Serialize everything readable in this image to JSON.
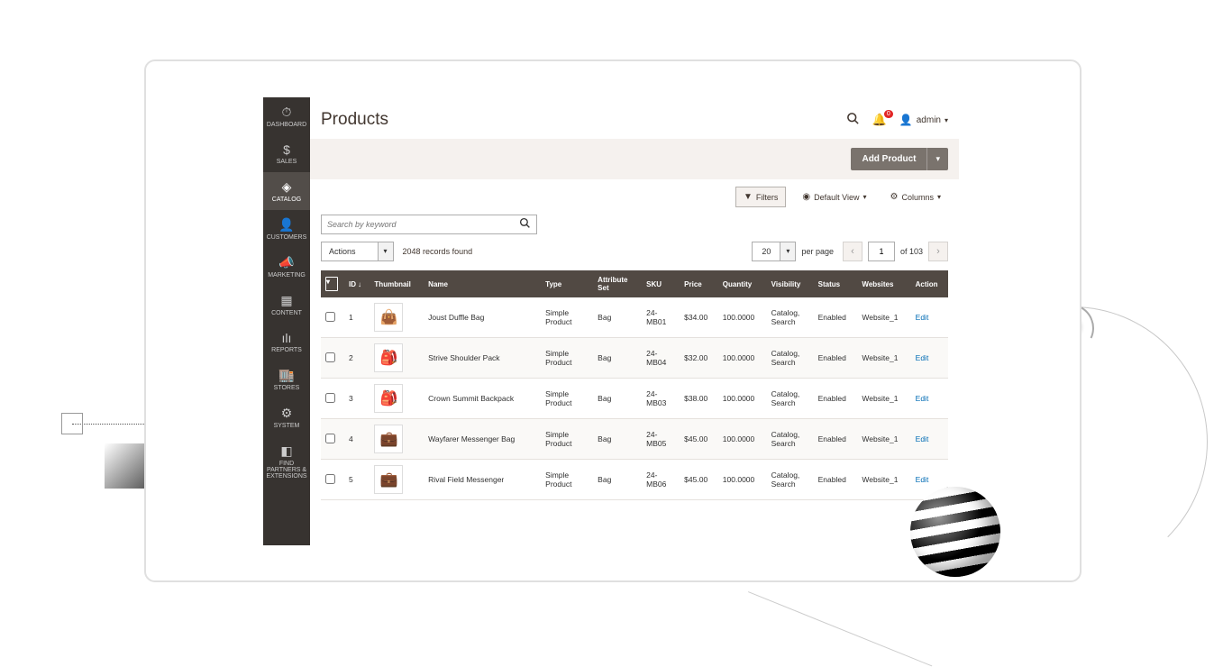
{
  "header": {
    "title": "Products",
    "notification_count": "0",
    "user_label": "admin"
  },
  "sidebar": {
    "items": [
      {
        "label": "DASHBOARD",
        "icon": "⏱"
      },
      {
        "label": "SALES",
        "icon": "$"
      },
      {
        "label": "CATALOG",
        "icon": "◈",
        "active": true
      },
      {
        "label": "CUSTOMERS",
        "icon": "👤"
      },
      {
        "label": "MARKETING",
        "icon": "📣"
      },
      {
        "label": "CONTENT",
        "icon": "▦"
      },
      {
        "label": "REPORTS",
        "icon": "ılı"
      },
      {
        "label": "STORES",
        "icon": "🏬"
      },
      {
        "label": "SYSTEM",
        "icon": "⚙"
      },
      {
        "label": "FIND PARTNERS & EXTENSIONS",
        "icon": "◧"
      }
    ]
  },
  "buttons": {
    "add_product": "Add Product"
  },
  "toolbar": {
    "filters": "Filters",
    "default_view": "Default View",
    "columns": "Columns"
  },
  "search": {
    "placeholder": "Search by keyword"
  },
  "actions": {
    "label": "Actions",
    "records_found": "2048 records found"
  },
  "paging": {
    "per_page_value": "20",
    "per_page_label": "per page",
    "current_page": "1",
    "total_pages_label": "of 103"
  },
  "table": {
    "headers": {
      "checkbox": "",
      "id": "ID",
      "thumbnail": "Thumbnail",
      "name": "Name",
      "type": "Type",
      "attribute_set": "Attribute Set",
      "sku": "SKU",
      "price": "Price",
      "quantity": "Quantity",
      "visibility": "Visibility",
      "status": "Status",
      "websites": "Websites",
      "action": "Action"
    },
    "rows": [
      {
        "id": "1",
        "thumb": "👜",
        "name": "Joust Duffle Bag",
        "type": "Simple Product",
        "set": "Bag",
        "sku": "24-MB01",
        "price": "$34.00",
        "qty": "100.0000",
        "vis": "Catalog, Search",
        "status": "Enabled",
        "web": "Website_1",
        "action": "Edit"
      },
      {
        "id": "2",
        "thumb": "🎒",
        "name": "Strive Shoulder Pack",
        "type": "Simple Product",
        "set": "Bag",
        "sku": "24-MB04",
        "price": "$32.00",
        "qty": "100.0000",
        "vis": "Catalog, Search",
        "status": "Enabled",
        "web": "Website_1",
        "action": "Edit"
      },
      {
        "id": "3",
        "thumb": "🎒",
        "name": "Crown Summit Backpack",
        "type": "Simple Product",
        "set": "Bag",
        "sku": "24-MB03",
        "price": "$38.00",
        "qty": "100.0000",
        "vis": "Catalog, Search",
        "status": "Enabled",
        "web": "Website_1",
        "action": "Edit"
      },
      {
        "id": "4",
        "thumb": "💼",
        "name": "Wayfarer Messenger Bag",
        "type": "Simple Product",
        "set": "Bag",
        "sku": "24-MB05",
        "price": "$45.00",
        "qty": "100.0000",
        "vis": "Catalog, Search",
        "status": "Enabled",
        "web": "Website_1",
        "action": "Edit"
      },
      {
        "id": "5",
        "thumb": "💼",
        "name": "Rival Field Messenger",
        "type": "Simple Product",
        "set": "Bag",
        "sku": "24-MB06",
        "price": "$45.00",
        "qty": "100.0000",
        "vis": "Catalog, Search",
        "status": "Enabled",
        "web": "Website_1",
        "action": "Edit"
      }
    ]
  }
}
